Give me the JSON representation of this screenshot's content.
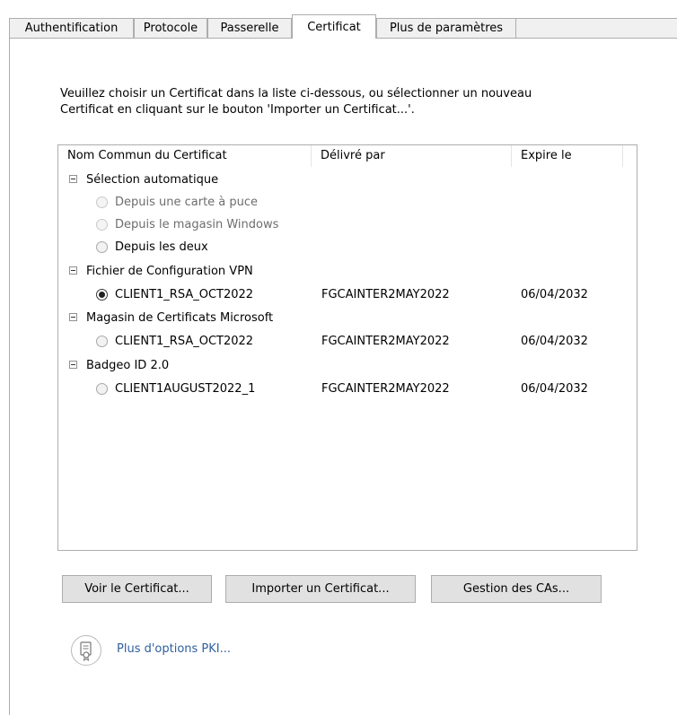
{
  "tabs": [
    {
      "label": "Authentification",
      "active": false
    },
    {
      "label": "Protocole",
      "active": false
    },
    {
      "label": "Passerelle",
      "active": false
    },
    {
      "label": "Certificat",
      "active": true
    },
    {
      "label": "Plus de paramètres",
      "active": false
    }
  ],
  "instructions": {
    "line1": "Veuillez choisir un Certificat dans la liste ci-dessous, ou sélectionner un nouveau",
    "line2": "Certificat en cliquant sur le bouton 'Importer un Certificat...'."
  },
  "list": {
    "columns": [
      "Nom Commun du Certificat",
      "Délivré par",
      "Expire le"
    ],
    "groups": [
      {
        "label": "Sélection automatique",
        "items": [
          {
            "name": "Depuis une carte à puce",
            "issuer": "",
            "expires": "",
            "checked": false,
            "disabled": true
          },
          {
            "name": "Depuis le magasin Windows",
            "issuer": "",
            "expires": "",
            "checked": false,
            "disabled": true
          },
          {
            "name": "Depuis les deux",
            "issuer": "",
            "expires": "",
            "checked": false,
            "disabled": false
          }
        ]
      },
      {
        "label": "Fichier de Configuration VPN",
        "items": [
          {
            "name": "CLIENT1_RSA_OCT2022",
            "issuer": "FGCAINTER2MAY2022",
            "expires": "06/04/2032",
            "checked": true,
            "disabled": false
          }
        ]
      },
      {
        "label": "Magasin de Certificats Microsoft",
        "items": [
          {
            "name": "CLIENT1_RSA_OCT2022",
            "issuer": "FGCAINTER2MAY2022",
            "expires": "06/04/2032",
            "checked": false,
            "disabled": false
          }
        ]
      },
      {
        "label": "Badgeo ID 2.0",
        "items": [
          {
            "name": "CLIENT1AUGUST2022_1",
            "issuer": "FGCAINTER2MAY2022",
            "expires": "06/04/2032",
            "checked": false,
            "disabled": false
          }
        ]
      }
    ]
  },
  "buttons": {
    "view": "Voir le Certificat...",
    "import": "Importer un Certificat...",
    "manage_cas": "Gestion des CAs..."
  },
  "pki": {
    "icon": "certificate-icon",
    "link": "Plus d'options PKI..."
  }
}
